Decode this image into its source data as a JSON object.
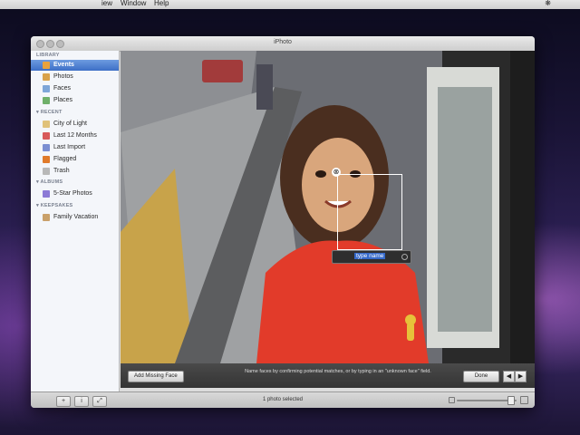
{
  "menubar": {
    "items": [
      "iew",
      "Window",
      "Help"
    ]
  },
  "window": {
    "title": "iPhoto"
  },
  "sidebar": {
    "library_header": "LIBRARY",
    "library_items": [
      {
        "label": "Events",
        "icon": "events-icon",
        "color": "#e8a23c",
        "selected": true
      },
      {
        "label": "Photos",
        "icon": "photos-icon",
        "color": "#d9a24a",
        "selected": false
      },
      {
        "label": "Faces",
        "icon": "faces-icon",
        "color": "#7ea6d8",
        "selected": false
      },
      {
        "label": "Places",
        "icon": "places-icon",
        "color": "#6fb06a",
        "selected": false
      }
    ],
    "recent_header": "RECENT",
    "recent_items": [
      {
        "label": "City of Light",
        "icon": "event-icon",
        "color": "#e0c27a"
      },
      {
        "label": "Last 12 Months",
        "icon": "calendar-icon",
        "color": "#d85a5a"
      },
      {
        "label": "Last Import",
        "icon": "import-icon",
        "color": "#7b8fd2"
      },
      {
        "label": "Flagged",
        "icon": "flag-icon",
        "color": "#e07a2a"
      },
      {
        "label": "Trash",
        "icon": "trash-icon",
        "color": "#b8b8b8"
      }
    ],
    "albums_header": "ALBUMS",
    "album_items": [
      {
        "label": "5-Star Photos",
        "icon": "smart-album-icon",
        "color": "#8c7ad6"
      }
    ],
    "keepsakes_header": "KEEPSAKES",
    "keepsake_items": [
      {
        "label": "Family Vacation",
        "icon": "book-icon",
        "color": "#c9a06a"
      }
    ]
  },
  "face_tag": {
    "close_glyph": "⊗",
    "name_placeholder": "type name"
  },
  "toolbar": {
    "add_missing_face": "Add Missing Face",
    "instructions": "Name faces by confirming potential matches, or by typing in an \"unknown face\" field.",
    "done": "Done",
    "prev_glyph": "◀",
    "next_glyph": "▶"
  },
  "statusbar": {
    "add_glyph": "+",
    "info_glyph": "i",
    "fullscreen_glyph": "⤢",
    "status": "1 photo selected",
    "zoom_level": 0.9
  }
}
